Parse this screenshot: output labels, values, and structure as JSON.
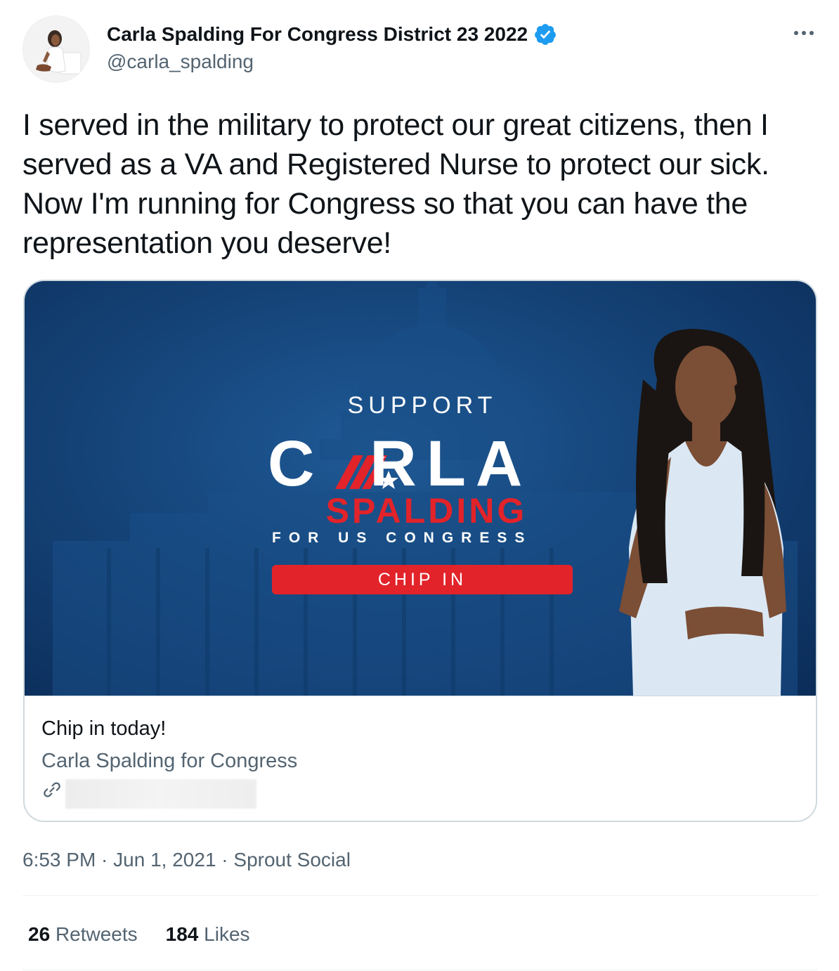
{
  "author": {
    "display_name": "Carla Spalding For Congress District 23 2022",
    "handle": "@carla_spalding",
    "verified": true
  },
  "tweet": {
    "text": "I served in the military to protect our great citizens, then I served as a VA and Registered Nurse to protect our sick. Now I'm running for Congress so that you can have the representation you deserve!"
  },
  "card": {
    "banner": {
      "support": "SUPPORT",
      "carla": "C  RLA",
      "spalding": "SPALDING",
      "for_us_congress": "FOR US CONGRESS",
      "chip_in": "CHIP IN"
    },
    "title": "Chip in today!",
    "site": "Carla Spalding for Congress"
  },
  "meta": {
    "time": "6:53 PM",
    "separator": " · ",
    "date": "Jun 1, 2021",
    "source": "Sprout Social"
  },
  "stats": {
    "retweets_count": "26",
    "retweets_label": "Retweets",
    "likes_count": "184",
    "likes_label": "Likes"
  },
  "colors": {
    "verified_blue": "#1d9bf0",
    "banner_red": "#e2232a",
    "banner_blue": "#154479"
  }
}
